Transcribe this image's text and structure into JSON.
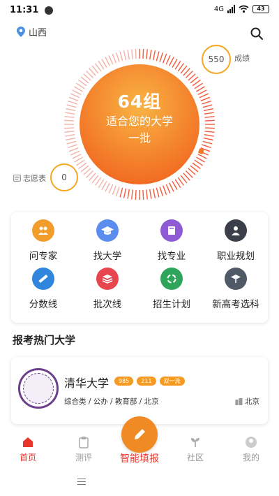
{
  "status": {
    "time": "11:31",
    "network": "4G",
    "battery": "43"
  },
  "header": {
    "location": "山西",
    "icons": [
      "location-pin-icon",
      "search-icon"
    ]
  },
  "hero": {
    "count": "64组",
    "subtitle": "适合您的大学",
    "batch": "一批",
    "score_value": "550",
    "score_label": "成绩",
    "wish_label": "志愿表",
    "wish_value": "0",
    "colors": {
      "center_start": "#f7a437",
      "center_end": "#f26b22",
      "ring": "#f35a3c",
      "circle_border": "#f5a623"
    }
  },
  "features": [
    {
      "label": "问专家",
      "icon": "experts-icon",
      "color": "#f29c2b"
    },
    {
      "label": "找大学",
      "icon": "graduation-cap-icon",
      "color": "#5b8def"
    },
    {
      "label": "找专业",
      "icon": "book-icon",
      "color": "#8e5ad6"
    },
    {
      "label": "职业规划",
      "icon": "career-icon",
      "color": "#3b3f4a"
    },
    {
      "label": "分数线",
      "icon": "ruler-icon",
      "color": "#2f86dc"
    },
    {
      "label": "批次线",
      "icon": "layers-icon",
      "color": "#e8464f"
    },
    {
      "label": "招生计划",
      "icon": "recycle-plan-icon",
      "color": "#2fa55b"
    },
    {
      "label": "新高考选科",
      "icon": "subject-select-icon",
      "color": "#4f5a66"
    }
  ],
  "hot": {
    "title": "报考热门大学",
    "university": {
      "name": "清华大学",
      "tags": [
        "985",
        "211",
        "双一流"
      ],
      "info": "综合类 / 公办 / 教育部 / 北京",
      "city": "北京"
    }
  },
  "nav": {
    "home": "首页",
    "test": "测评",
    "smart_fill": "智能填报",
    "community": "社区",
    "mine": "我的",
    "active_color": "#e8362d"
  }
}
